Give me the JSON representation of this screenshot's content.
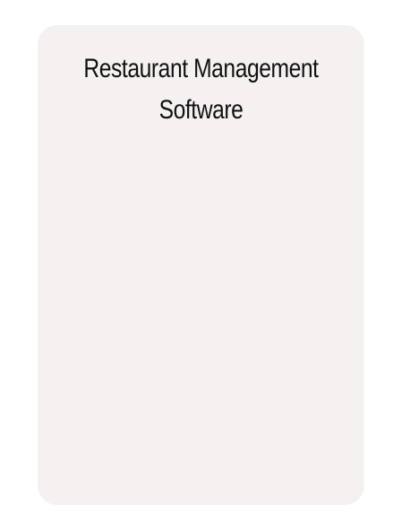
{
  "card": {
    "title_line1": "Restaurant Management",
    "title_line2": "Software"
  }
}
